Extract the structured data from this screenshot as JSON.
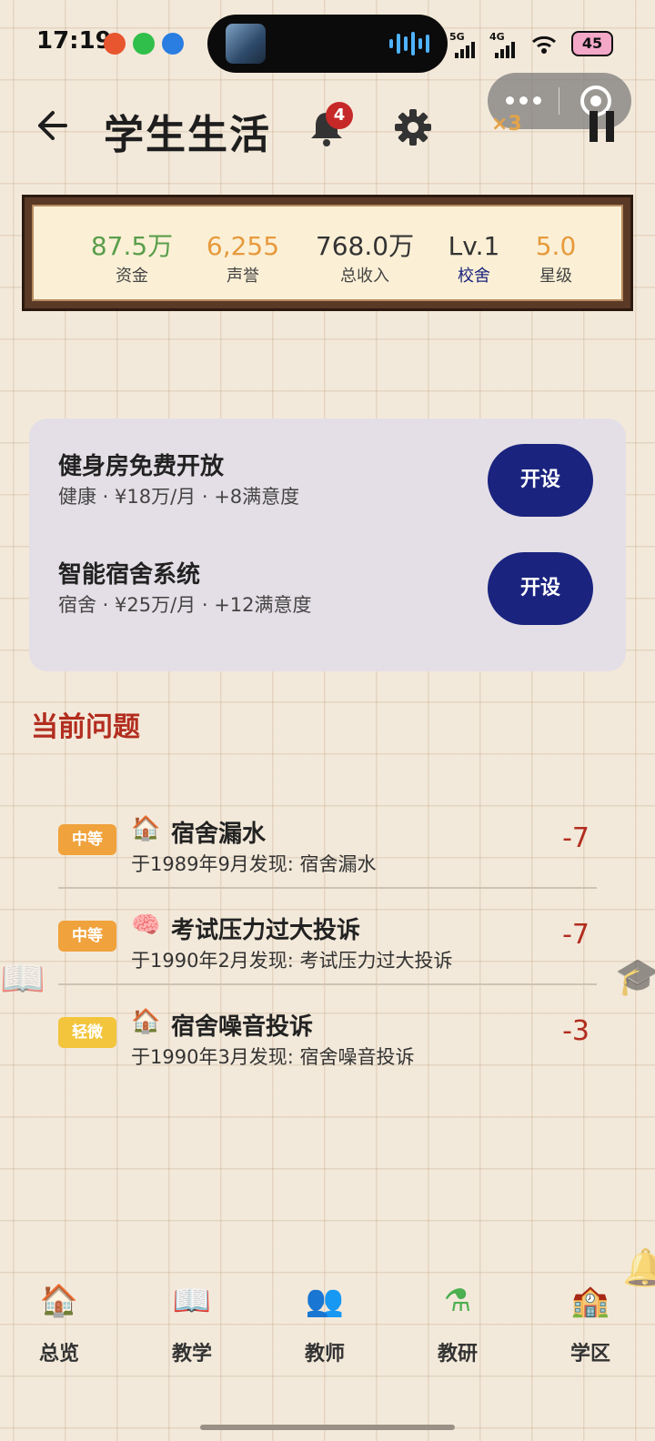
{
  "status_bar": {
    "time": "17:19",
    "network_1": "5G",
    "network_2": "4G",
    "battery": "45"
  },
  "header": {
    "title": "学生生活",
    "notification_count": "4",
    "speed": "×3"
  },
  "stats": [
    {
      "value": "87.5万",
      "label": "资金",
      "value_color": "#5a9e4b",
      "label_color": "#444444"
    },
    {
      "value": "6,255",
      "label": "声誉",
      "value_color": "#e79a3c",
      "label_color": "#444444"
    },
    {
      "value": "768.0万",
      "label": "总收入",
      "value_color": "#333333",
      "label_color": "#444444"
    },
    {
      "value": "Lv.1",
      "label": "校舍",
      "value_color": "#333333",
      "label_color": "#1a237e"
    },
    {
      "value": "5.0",
      "label": "星级",
      "value_color": "#e79a3c",
      "label_color": "#444444"
    }
  ],
  "facilities": [
    {
      "name": "健身房免费开放",
      "detail": "健康 · ¥18万/月 · +8满意度",
      "button": "开设"
    },
    {
      "name": "智能宿舍系统",
      "detail": "宿舍 · ¥25万/月 · +12满意度",
      "button": "开设"
    }
  ],
  "issues_section": {
    "title": "当前问题",
    "items": [
      {
        "severity": "中等",
        "severity_color": "#f0a23c",
        "icon": "house-icon",
        "glyph": "🏠",
        "title": "宿舍漏水",
        "desc": "于1989年9月发现: 宿舍漏水",
        "impact": "-7"
      },
      {
        "severity": "中等",
        "severity_color": "#f0a23c",
        "icon": "brain-icon",
        "glyph": "🧠",
        "title": "考试压力过大投诉",
        "desc": "于1990年2月发现: 考试压力过大投诉",
        "impact": "-7"
      },
      {
        "severity": "轻微",
        "severity_color": "#f2c53d",
        "icon": "house-icon",
        "glyph": "🏠",
        "title": "宿舍噪音投诉",
        "desc": "于1990年3月发现: 宿舍噪音投诉",
        "impact": "-3"
      }
    ]
  },
  "bottom_nav": [
    {
      "label": "总览",
      "icon": "house-icon",
      "glyph": "🏠"
    },
    {
      "label": "教学",
      "icon": "book-icon",
      "glyph": "📖"
    },
    {
      "label": "教师",
      "icon": "teachers-icon",
      "glyph": "👥"
    },
    {
      "label": "教研",
      "icon": "flask-icon",
      "glyph": "⚗"
    },
    {
      "label": "学区",
      "icon": "school-icon",
      "glyph": "🏫"
    }
  ]
}
